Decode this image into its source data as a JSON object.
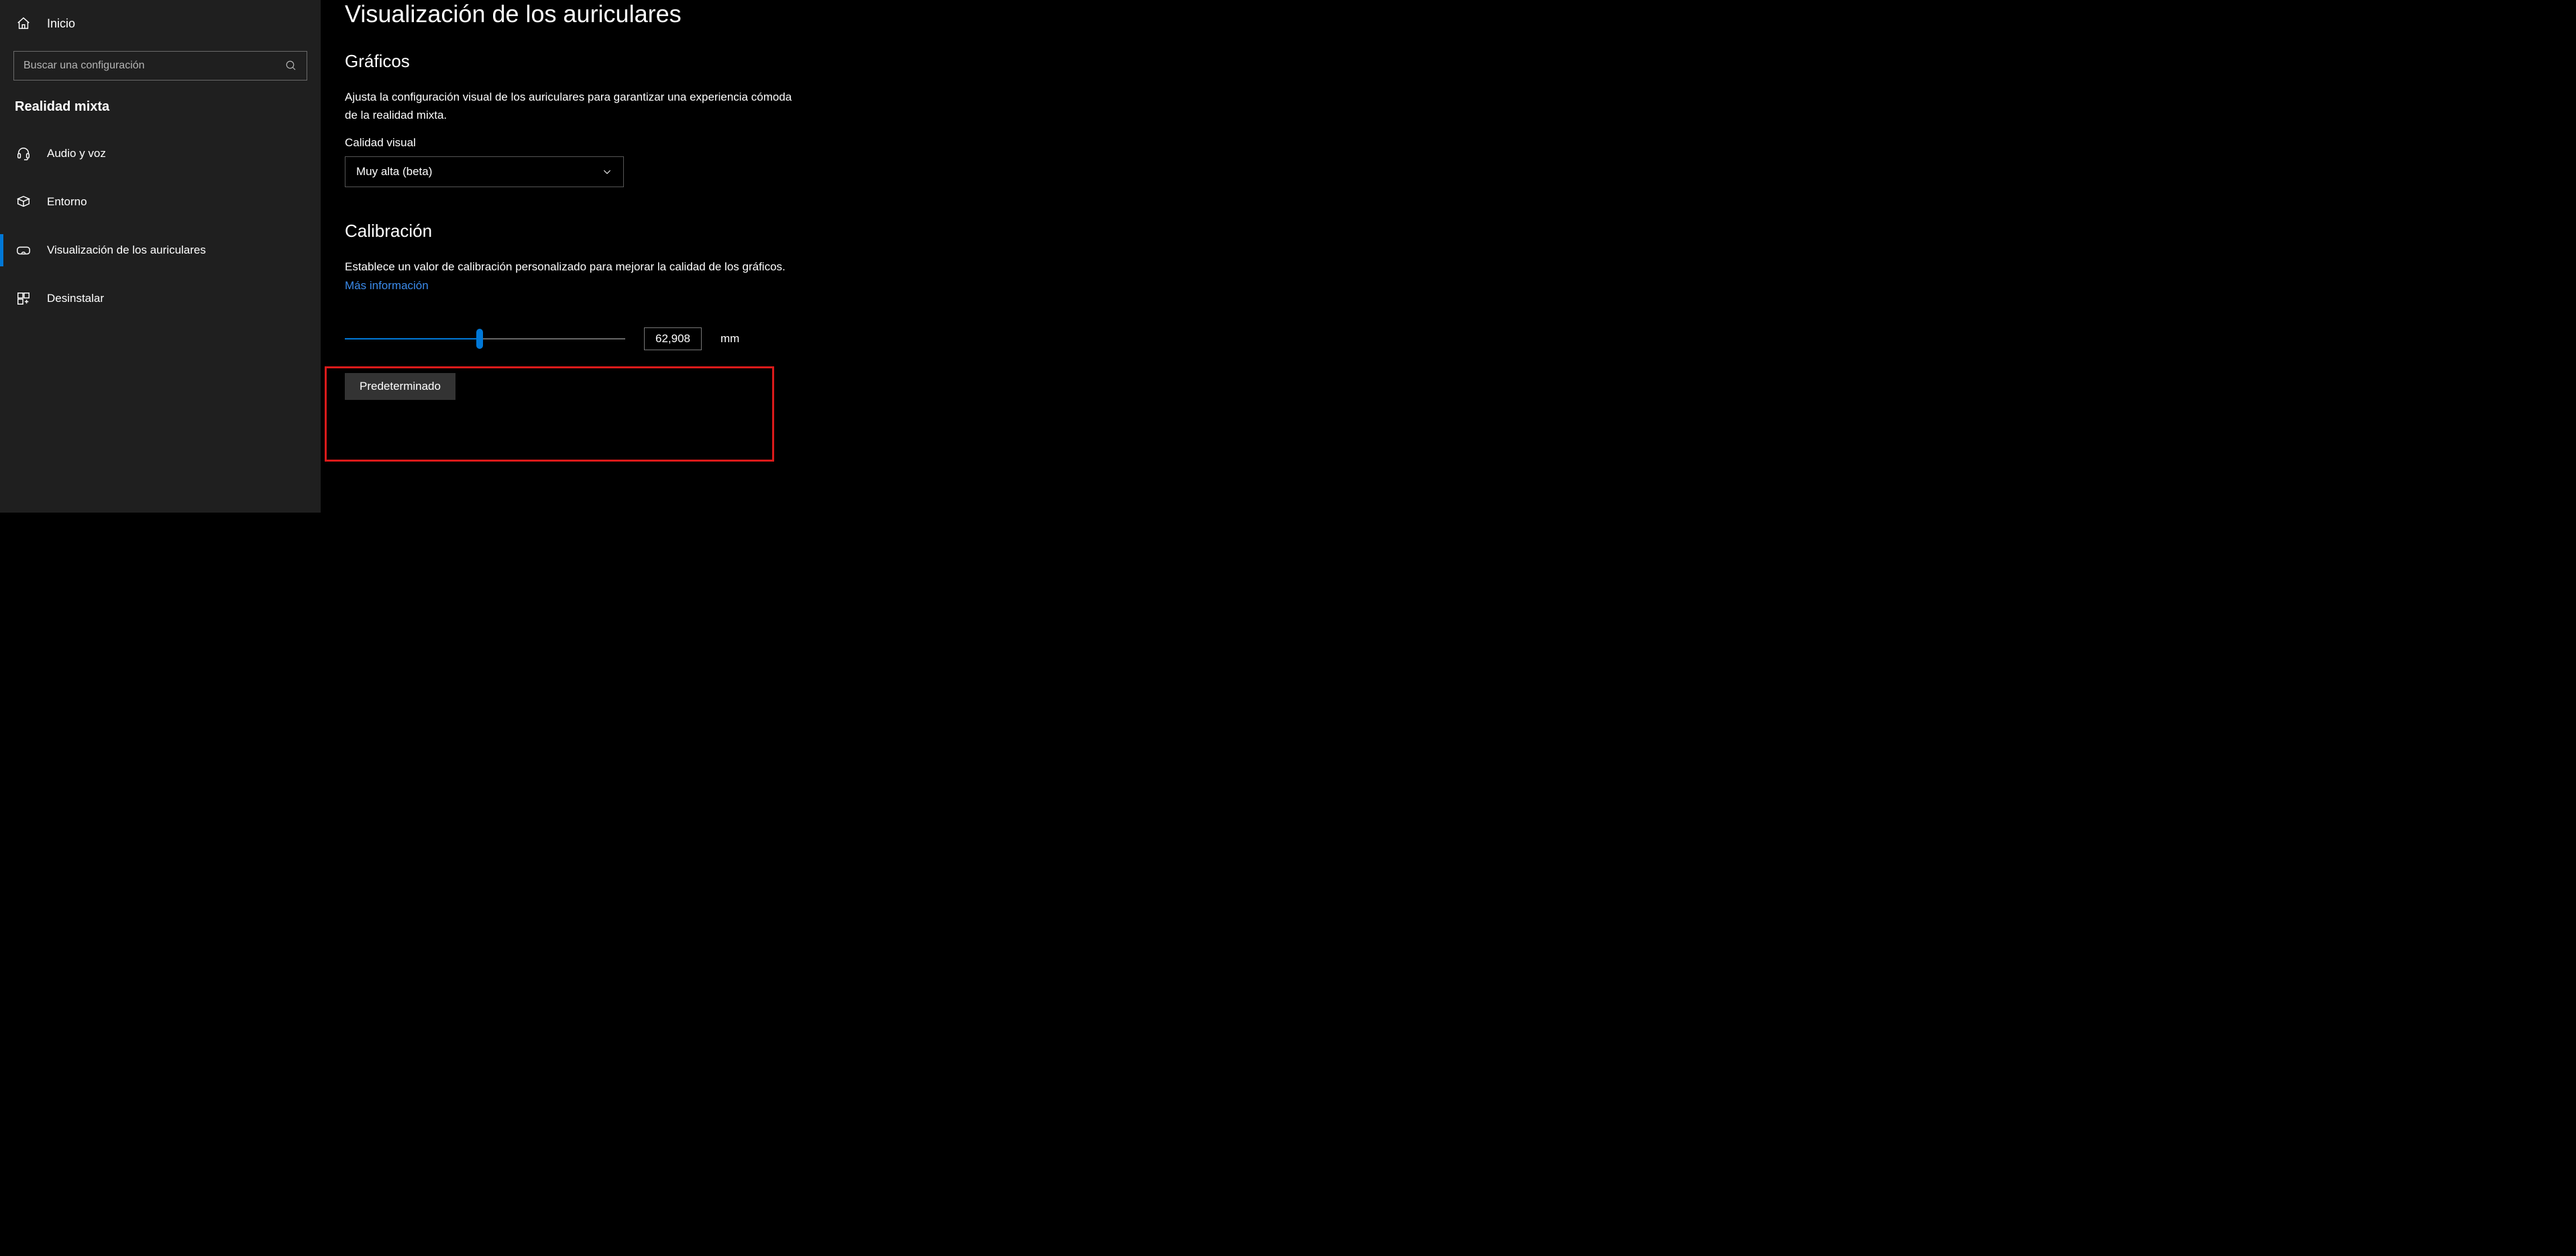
{
  "sidebar": {
    "home_label": "Inicio",
    "search_placeholder": "Buscar una configuración",
    "category_title": "Realidad mixta",
    "items": [
      {
        "label": "Audio y voz"
      },
      {
        "label": "Entorno"
      },
      {
        "label": "Visualización de los auriculares"
      },
      {
        "label": "Desinstalar"
      }
    ]
  },
  "main": {
    "page_title": "Visualización de los auriculares",
    "graphics": {
      "section_title": "Gráficos",
      "description": "Ajusta la configuración visual de los auriculares para garantizar una experiencia cómoda de la realidad mixta.",
      "quality_label": "Calidad visual",
      "quality_value": "Muy alta (beta)"
    },
    "calibration": {
      "section_title": "Calibración",
      "description": "Establece un valor de calibración personalizado para mejorar la calidad de los gráficos.",
      "more_info": "Más información",
      "value": "62,908",
      "unit": "mm",
      "default_button": "Predeterminado"
    }
  }
}
